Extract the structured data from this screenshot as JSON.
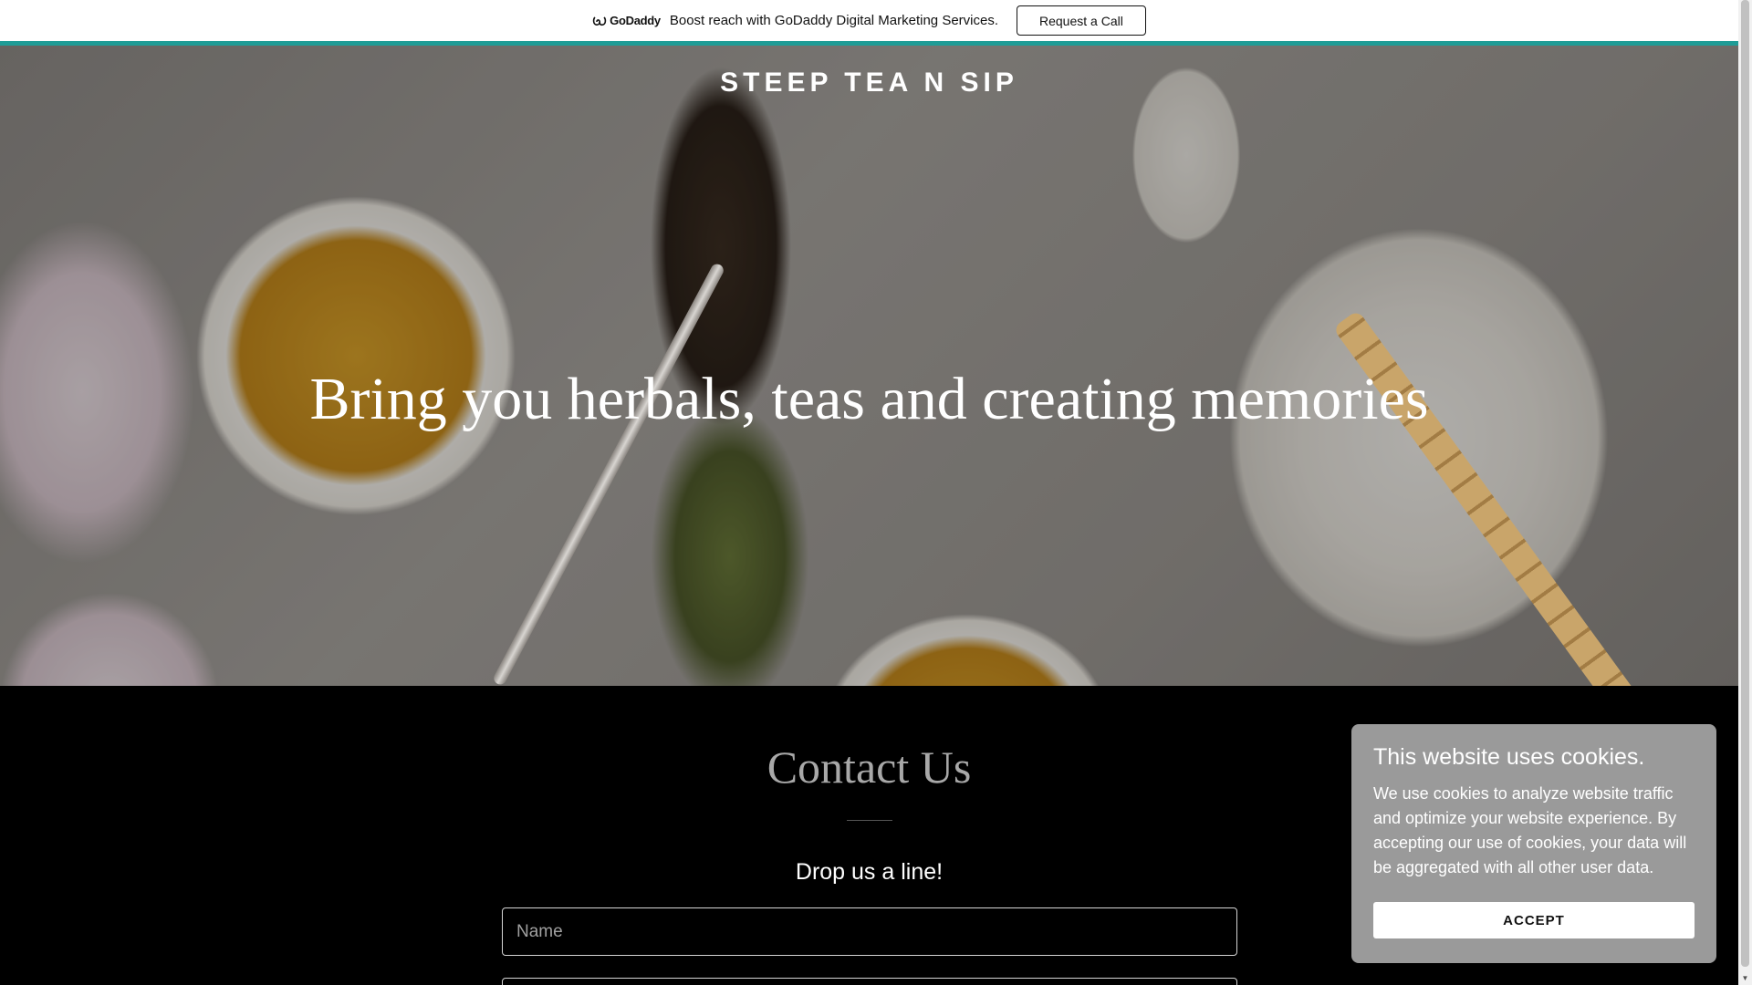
{
  "promo": {
    "brand": "GoDaddy",
    "text": "Boost reach with GoDaddy Digital Marketing Services.",
    "button_label": "Request a Call",
    "accent_color": "#1f9c96"
  },
  "header": {
    "site_title": "STEEP TEA N SIP"
  },
  "hero": {
    "headline": "Bring you herbals, teas and creating memories"
  },
  "contact": {
    "title": "Contact Us",
    "subtitle": "Drop us a line!",
    "name_placeholder": "Name",
    "email_placeholder": ""
  },
  "cookie": {
    "title": "This website uses cookies.",
    "body": "We use cookies to analyze website traffic and optimize your website experience. By accepting our use of cookies, your data will be aggregated with all other user data.",
    "accept_label": "ACCEPT"
  },
  "icons": {
    "logo": "godaddy-logo-icon",
    "scroll_down": "chevron-down-icon"
  }
}
